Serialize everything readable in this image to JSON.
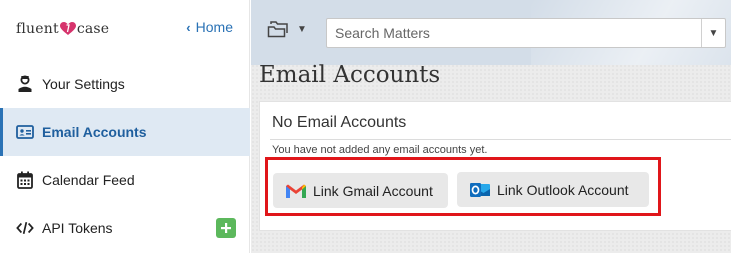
{
  "brand": {
    "name_left": "fluent",
    "name_right": "case",
    "logo_icon": "heart-icon"
  },
  "sidebar": {
    "home_label": "Home",
    "items": [
      {
        "label": "Your Settings",
        "icon": "user-icon"
      },
      {
        "label": "Email Accounts",
        "icon": "mail-card-icon",
        "active": true
      },
      {
        "label": "Calendar Feed",
        "icon": "calendar-icon"
      },
      {
        "label": "API Tokens",
        "icon": "code-icon"
      }
    ]
  },
  "topbar": {
    "search_placeholder": "Search Matters"
  },
  "page": {
    "title": "Email Accounts"
  },
  "panel": {
    "title": "No Email Accounts",
    "message": "You have not added any email accounts yet.",
    "gmail_button": "Link Gmail Account",
    "outlook_button": "Link Outlook Account"
  },
  "colors": {
    "accent": "#2a72b5",
    "active_bg": "#dfe9f3",
    "add_green": "#5cb85c",
    "highlight_red": "#e0161a",
    "brand_heart": "#d6336c"
  }
}
